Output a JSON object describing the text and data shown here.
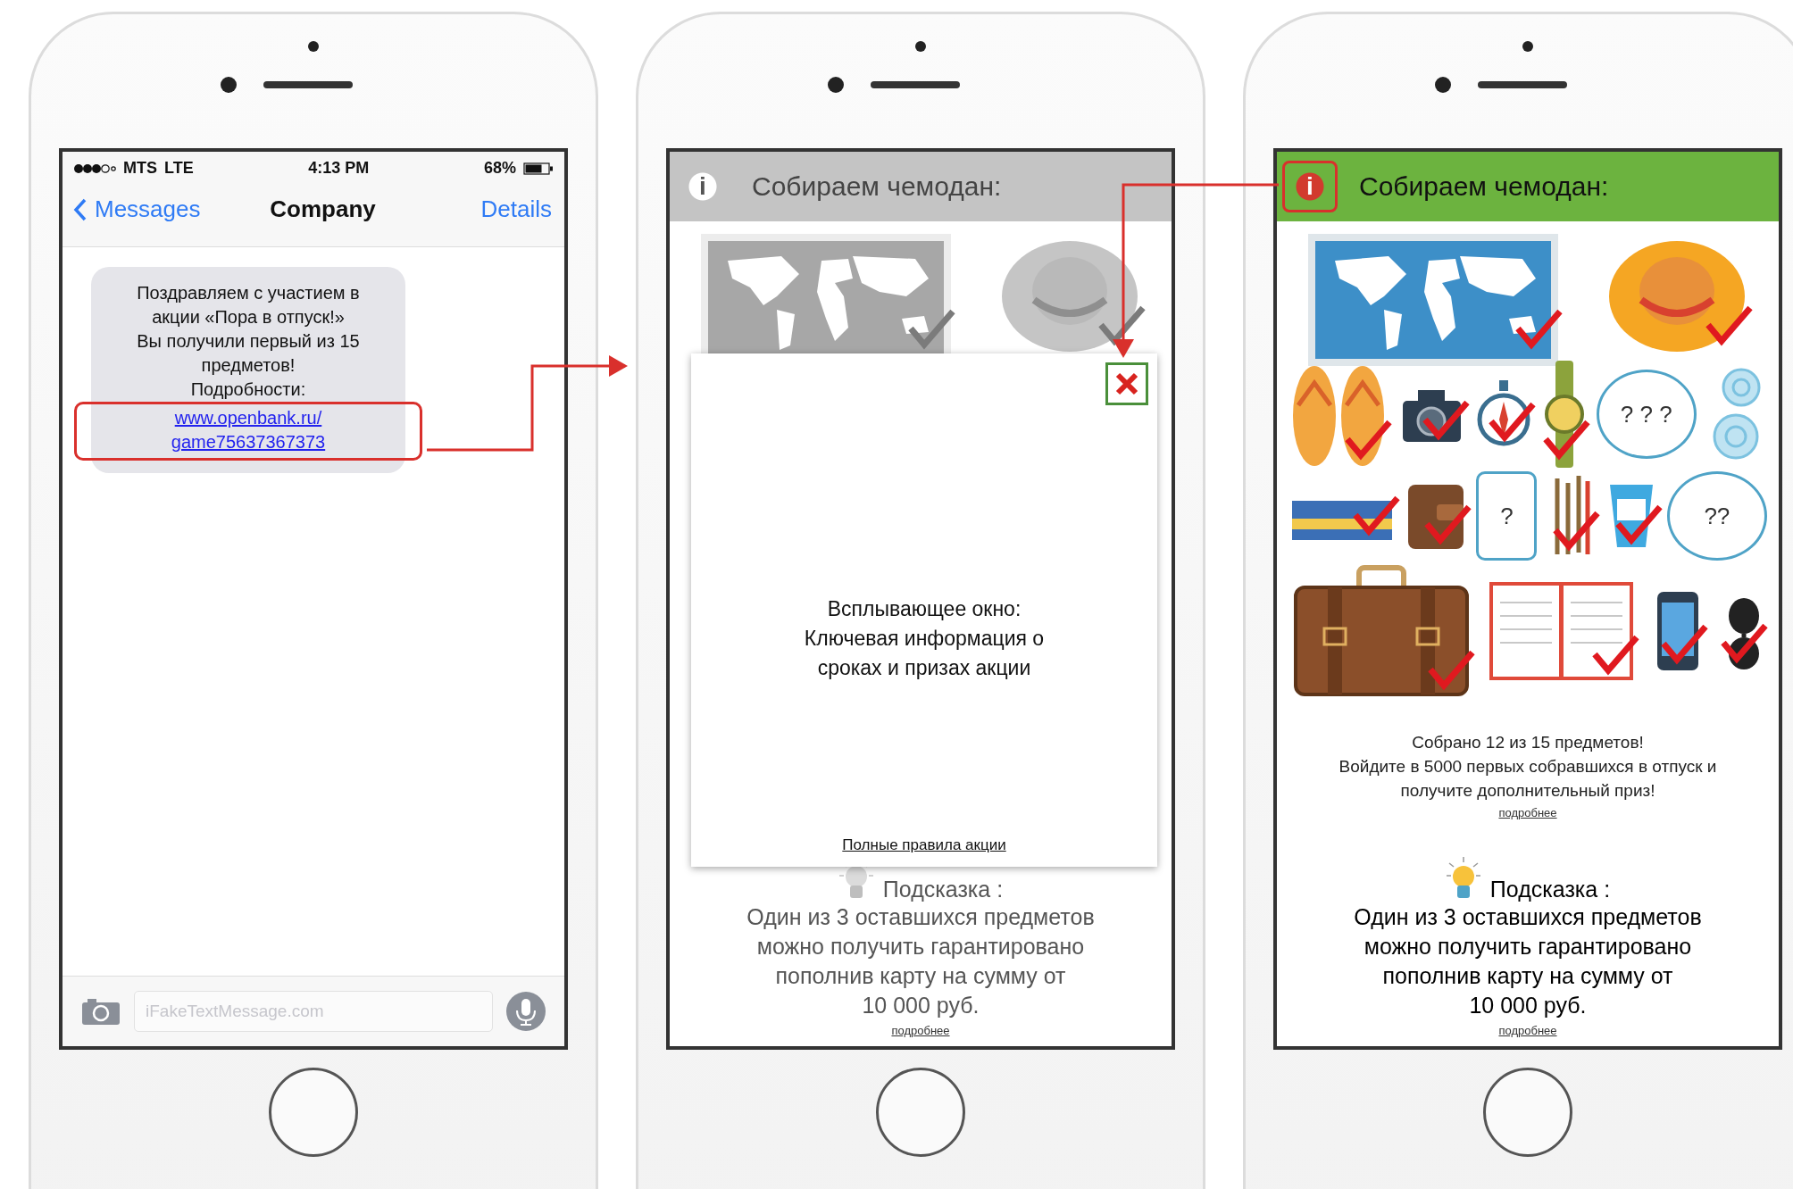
{
  "phones": [
    {
      "kind": "messages",
      "status_bar": {
        "carrier": "MTS",
        "network": "LTE",
        "time": "4:13 PM",
        "battery": "68%"
      },
      "nav": {
        "back": "Messages",
        "title": "Company",
        "action": "Details"
      },
      "message": {
        "text": "Поздравляем с участием в\nакции «Пора в отпуск!»\nВы получили первый из 15\nпредметов!\nПодробности:",
        "link": "www.openbank.ru/\ngame75637367373",
        "highlighted": true
      },
      "composer": {
        "placeholder": "iFakeTextMessage.com"
      }
    },
    {
      "kind": "game",
      "dimmed": true,
      "header": {
        "icon_label": "i",
        "title": "Собираем чемодан:",
        "highlighted": false
      },
      "rows": [
        [
          {
            "kind": "map",
            "checked": true
          },
          {
            "kind": "hat",
            "checked": true
          }
        ]
      ],
      "popup": {
        "text": "Всплывающее окно:\nКлючевая информация о\nсроках и призах акции",
        "rules_link": "Полные правила акции"
      },
      "hint": {
        "label": "Подсказка :",
        "text": "Один из 3 оставшихся предметов\nможно получить гарантировано\nпополнив карту на сумму от\n10 000 руб.",
        "more": "подробнее"
      }
    },
    {
      "kind": "game",
      "dimmed": false,
      "header": {
        "icon_label": "i",
        "title": "Собираем чемодан:",
        "highlighted": true
      },
      "rows": [
        [
          {
            "kind": "map",
            "checked": true
          },
          {
            "kind": "hat",
            "checked": true
          }
        ],
        [
          {
            "kind": "flipflops",
            "checked": true
          },
          {
            "kind": "camera",
            "checked": true
          },
          {
            "kind": "compass",
            "checked": true
          },
          {
            "kind": "watch",
            "checked": true
          },
          {
            "kind": "orb",
            "label": "? ? ?"
          },
          {
            "kind": "shells",
            "checked": false
          }
        ],
        [
          {
            "kind": "tickets",
            "checked": true
          },
          {
            "kind": "wallet",
            "checked": true
          },
          {
            "kind": "card",
            "label": "?"
          },
          {
            "kind": "pens",
            "checked": true
          },
          {
            "kind": "sunscreen",
            "checked": true
          },
          {
            "kind": "orb",
            "label": "??"
          }
        ],
        [
          {
            "kind": "suitcase",
            "checked": true
          },
          {
            "kind": "book",
            "checked": true
          },
          {
            "kind": "phone",
            "checked": true
          },
          {
            "kind": "sunglasses",
            "checked": true
          }
        ]
      ],
      "summary": {
        "text": "Собрано 12 из 15 предметов!\nВойдите в 5000 первых собравшихся в отпуск и\nполучите дополнительный приз!",
        "more": "подробнее"
      },
      "hint": {
        "label": "Подсказка :",
        "text": "Один из 3 оставшихся предметов\nможно получить гарантировано\nпополнив карту на сумму от\n10 000 руб.",
        "more": "подробнее"
      }
    }
  ]
}
